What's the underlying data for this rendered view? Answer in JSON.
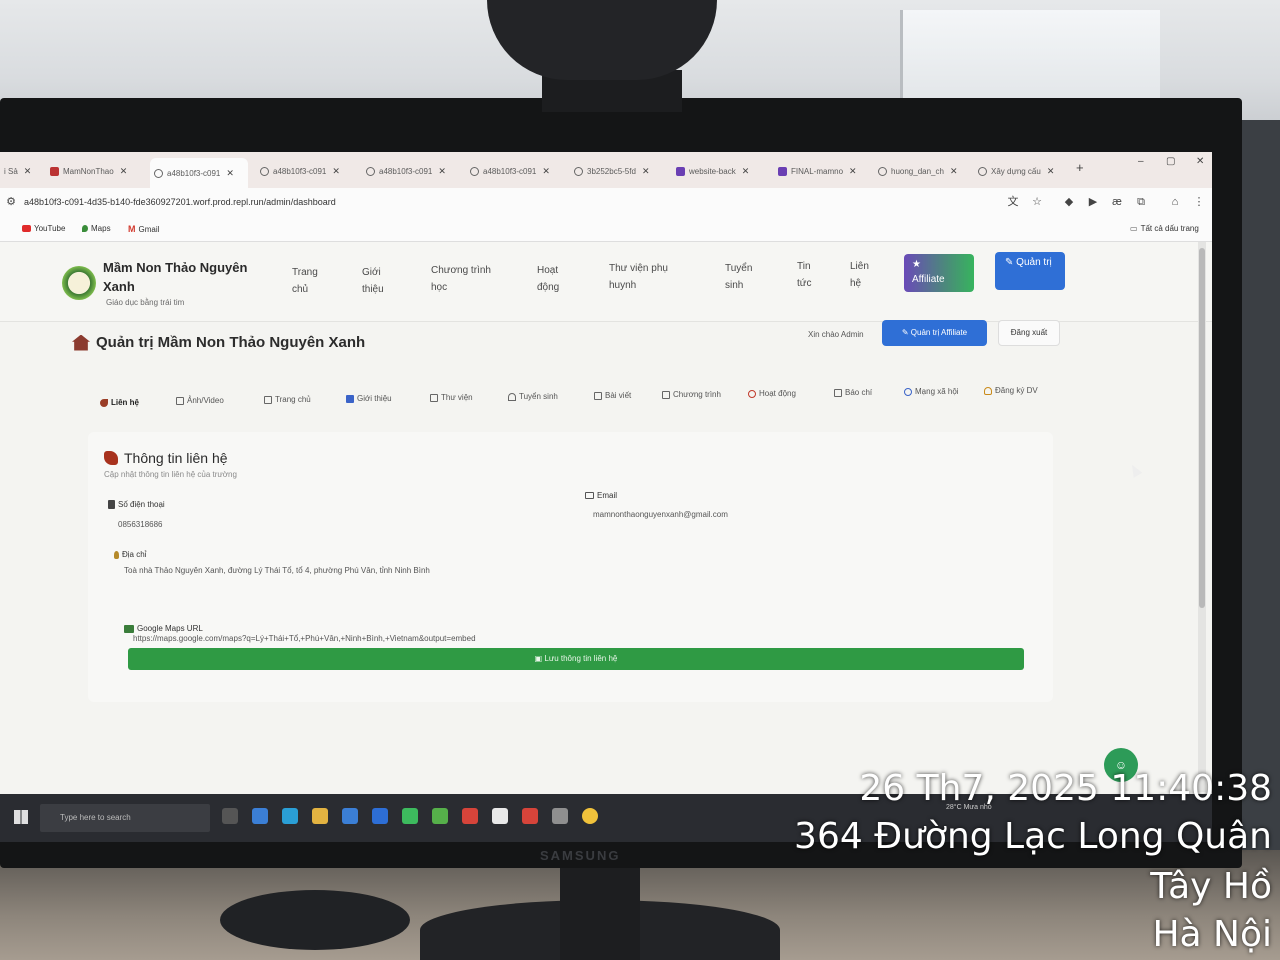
{
  "browser": {
    "tabs": [
      {
        "label": "MamNonThao",
        "icon": "generic-icon"
      },
      {
        "label": "a48b10f3-c091",
        "icon": "globe-icon"
      },
      {
        "label": "a48b10f3-c091",
        "icon": "globe-icon"
      },
      {
        "label": "a48b10f3-c091",
        "icon": "globe-icon"
      },
      {
        "label": "a48b10f3-c091",
        "icon": "globe-icon"
      },
      {
        "label": "3b252bc5-5fd",
        "icon": "globe-icon"
      },
      {
        "label": "website-back",
        "icon": "w-icon"
      },
      {
        "label": "FINAL-mamno",
        "icon": "w-icon"
      },
      {
        "label": "huong_dan_ch",
        "icon": "globe-icon"
      },
      {
        "label": "Xây dựng cấu",
        "icon": "globe-icon"
      }
    ],
    "url": "a48b10f3-c091-4d35-b140-fde360927201.worf.prod.repl.run/admin/dashboard",
    "bookmarks": [
      {
        "label": "YouTube",
        "color": "#e02b2b"
      },
      {
        "label": "Maps",
        "color": "#3a8d3a"
      },
      {
        "label": "Gmail",
        "color": "#d23a2e"
      }
    ],
    "all_bookmarks": "Tất cả dấu trang"
  },
  "site": {
    "name": "Mầm Non Thảo Nguyên Xanh",
    "slogan": "Giáo dục bằng trái tim",
    "nav": [
      "Trang chủ",
      "Giới thiệu",
      "Chương trình học",
      "Hoạt động",
      "Thư viện phụ huynh",
      "Tuyển sinh",
      "Tin tức",
      "Liên hệ"
    ],
    "affiliate_button": "Affiliate",
    "admin_button": "Quản trị"
  },
  "admin": {
    "title": "Quản trị Mầm Non Thảo Nguyên Xanh",
    "greeting": "Xin chào Admin",
    "manage_affiliate": "Quản trị Affiliate",
    "logout": "Đăng xuất",
    "tabs": [
      "Liên hệ",
      "Ảnh/Video",
      "Trang chủ",
      "Giới thiệu",
      "Thư viện",
      "Tuyển sinh",
      "Bài viết",
      "Chương trình",
      "Hoạt động",
      "Báo chí",
      "Mạng xã hội",
      "Đăng ký DV"
    ],
    "active_tab": "Liên hệ"
  },
  "contact_form": {
    "title": "Thông tin liên hệ",
    "subtitle": "Cập nhật thông tin liên hệ của trường",
    "phone_label": "Số điện thoại",
    "phone_value": "0856318686",
    "email_label": "Email",
    "email_value": "mamnonthaonguyenxanh@gmail.com",
    "address_label": "Địa chỉ",
    "address_value": "Toà nhà Thảo Nguyên Xanh, đường Lý Thái Tổ, tổ 4, phường Phú Vân, tỉnh Ninh Bình",
    "maps_label": "Google Maps URL",
    "maps_value": "https://maps.google.com/maps?q=Lý+Thái+Tổ,+Phú+Vân,+Ninh+Bình,+Vietnam&output=embed",
    "save_button": "Lưu thông tin liên hệ"
  },
  "taskbar": {
    "search_placeholder": "Type here to search",
    "weather": "28°C  Mưa nhỏ"
  },
  "photo_stamp": {
    "datetime": "26 Th7, 2025 11:40:38",
    "address_line1": "364 Đường Lạc Long Quân",
    "address_line2": "Tây Hồ",
    "address_line3": "Hà Nội"
  },
  "monitor_brand": "SAMSUNG"
}
